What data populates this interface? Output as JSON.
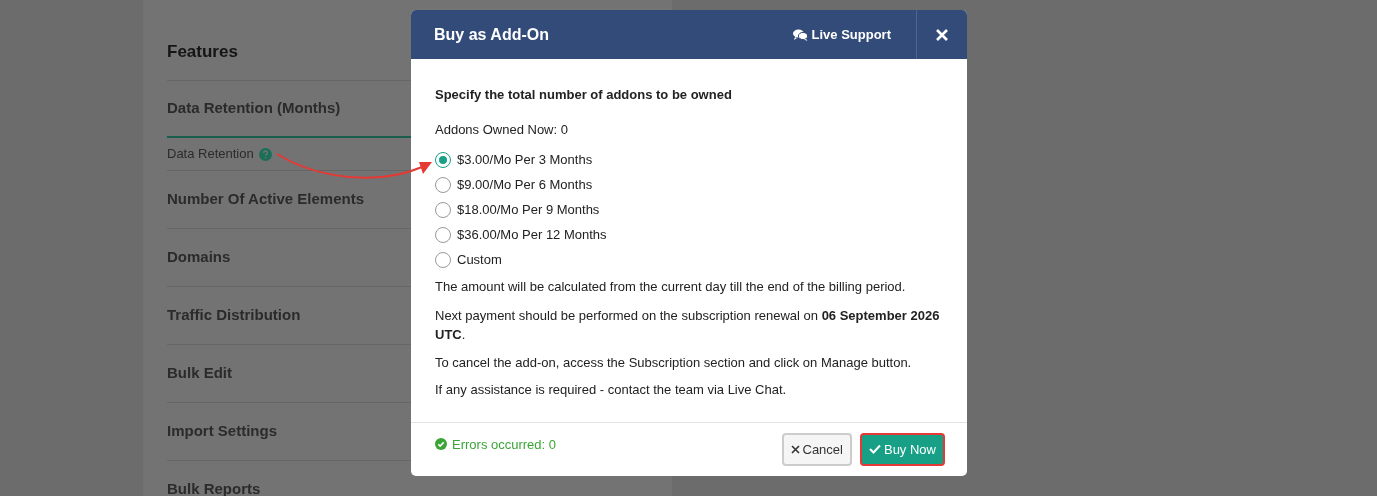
{
  "features": {
    "title": "Features",
    "items": [
      {
        "label": "Data Retention (Months)",
        "expanded": true,
        "sub_label": "Data Retention"
      },
      {
        "label": "Number Of Active Elements",
        "expanded": false
      },
      {
        "label": "Domains",
        "expanded": false
      },
      {
        "label": "Traffic Distribution",
        "expanded": false
      },
      {
        "label": "Bulk Edit",
        "expanded": false
      },
      {
        "label": "Import Settings",
        "expanded": false
      },
      {
        "label": "Bulk Reports",
        "expanded": false
      }
    ]
  },
  "modal": {
    "title": "Buy as Add-On",
    "live_support": "Live Support",
    "heading": "Specify the total number of addons to be owned",
    "owned": "Addons Owned Now: 0",
    "options": [
      {
        "label": "$3.00/Mo Per 3 Months",
        "selected": true
      },
      {
        "label": "$9.00/Mo Per 6 Months",
        "selected": false
      },
      {
        "label": "$18.00/Mo Per 9 Months",
        "selected": false
      },
      {
        "label": "$36.00/Mo Per 12 Months",
        "selected": false
      },
      {
        "label": "Custom",
        "selected": false
      }
    ],
    "notes": [
      "The amount will be calculated from the current day till the end of the billing period.",
      "Next payment should be performed on the subscription renewal on **06 September 2026 UTC**.",
      "To cancel the add-on, access the Subscription section and click on Manage button.",
      "If any assistance is required - contact the team via Live Chat."
    ],
    "status": "Errors occurred: 0",
    "buttons": [
      {
        "kind": "cancel",
        "label": "Cancel",
        "highlighted": false
      },
      {
        "kind": "confirm",
        "label": "Buy Now",
        "highlighted": true
      }
    ]
  }
}
